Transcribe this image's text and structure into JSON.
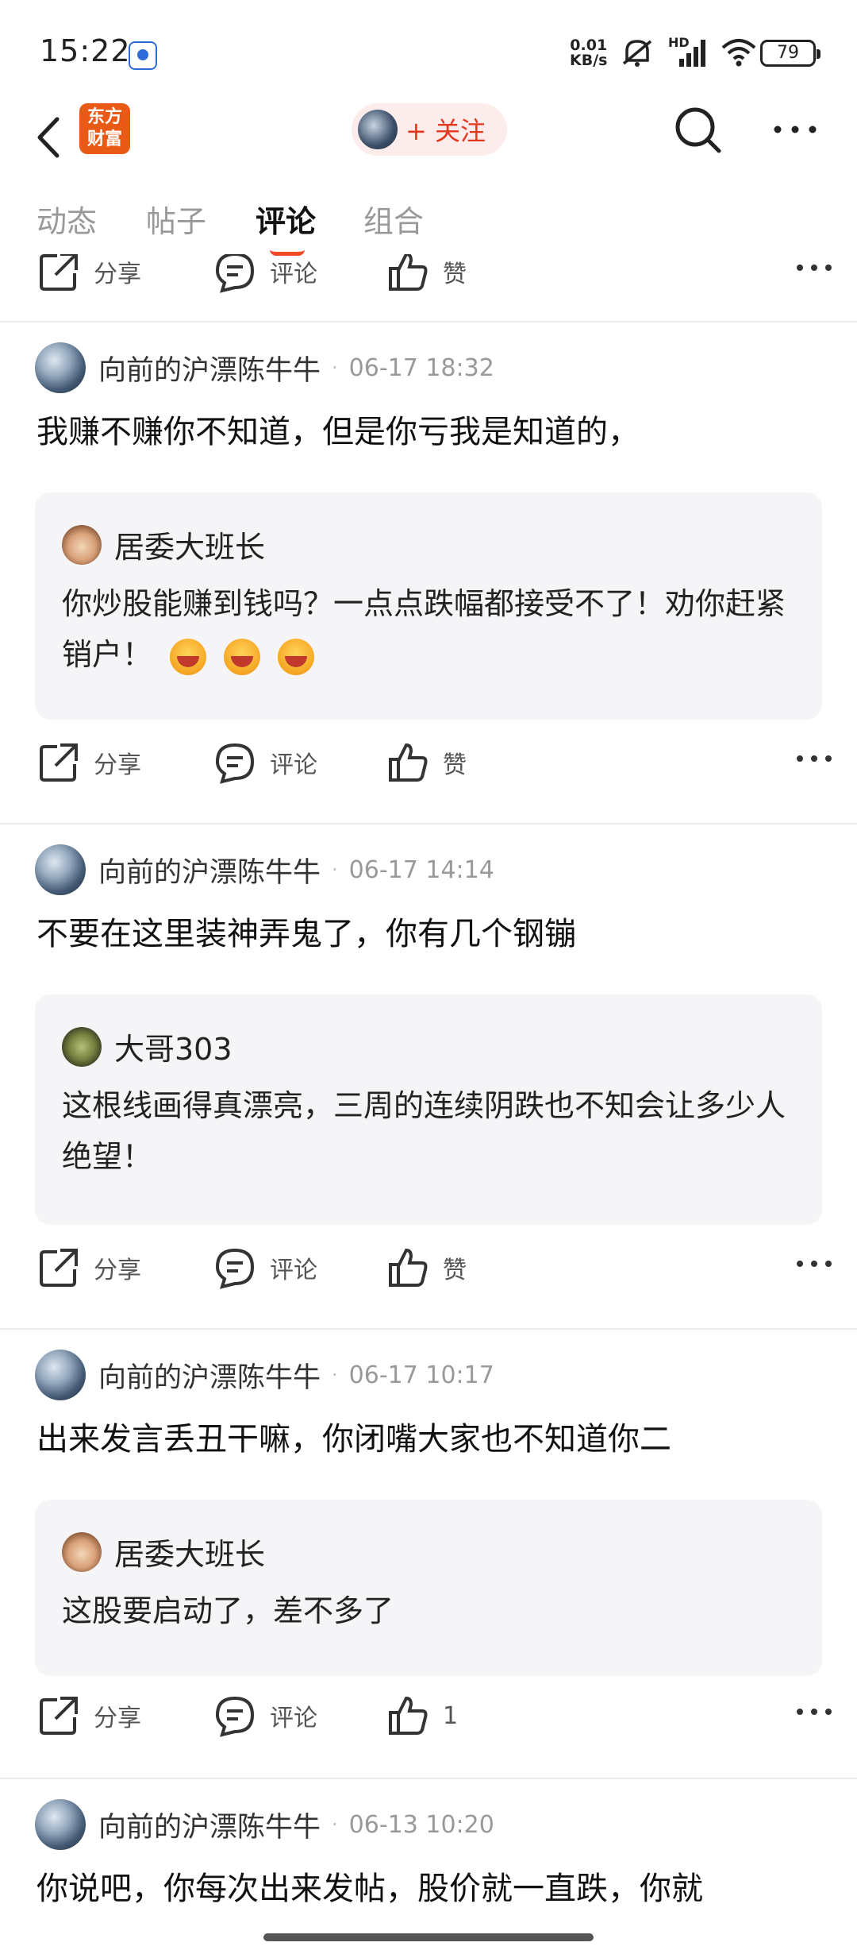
{
  "status_bar": {
    "time": "15:22",
    "net_speed_top": "0.01",
    "net_speed_bottom": "KB/s",
    "signal_label": "HD",
    "battery": "79"
  },
  "header": {
    "brand_line1": "东方",
    "brand_line2": "财富",
    "follow_label": "+ 关注"
  },
  "tabs": [
    {
      "label": "动态"
    },
    {
      "label": "帖子"
    },
    {
      "label": "评论"
    },
    {
      "label": "组合"
    }
  ],
  "actions": {
    "share": "分享",
    "comment": "评论",
    "like": "赞"
  },
  "posts": [
    {
      "author": "向前的沪漂陈牛牛",
      "time": "06-17 18:32",
      "text": "我赚不赚你不知道，但是你亏我是知道的，",
      "quote_author": "居委大班长",
      "quote_text": "你炒股能赚到钱吗？一点点跌幅都接受不了！劝你赶紧销户！",
      "like_label": "赞"
    },
    {
      "author": "向前的沪漂陈牛牛",
      "time": "06-17 14:14",
      "text": "不要在这里装神弄鬼了，你有几个钢镚",
      "quote_author": "大哥303",
      "quote_text": "这根线画得真漂亮，三周的连续阴跌也不知会让多少人绝望！",
      "like_label": "赞"
    },
    {
      "author": "向前的沪漂陈牛牛",
      "time": "06-17 10:17",
      "text": "出来发言丢丑干嘛，你闭嘴大家也不知道你二",
      "quote_author": "居委大班长",
      "quote_text": "这股要启动了，差不多了",
      "like_label": "1"
    },
    {
      "author": "向前的沪漂陈牛牛",
      "time": "06-13 10:20",
      "text": "你说吧，你每次出来发帖，股价就一直跌，你就"
    }
  ],
  "colors": {
    "accent": "#ef4a23",
    "brand": "#ea5a17",
    "follow_bg": "#fdecec"
  }
}
